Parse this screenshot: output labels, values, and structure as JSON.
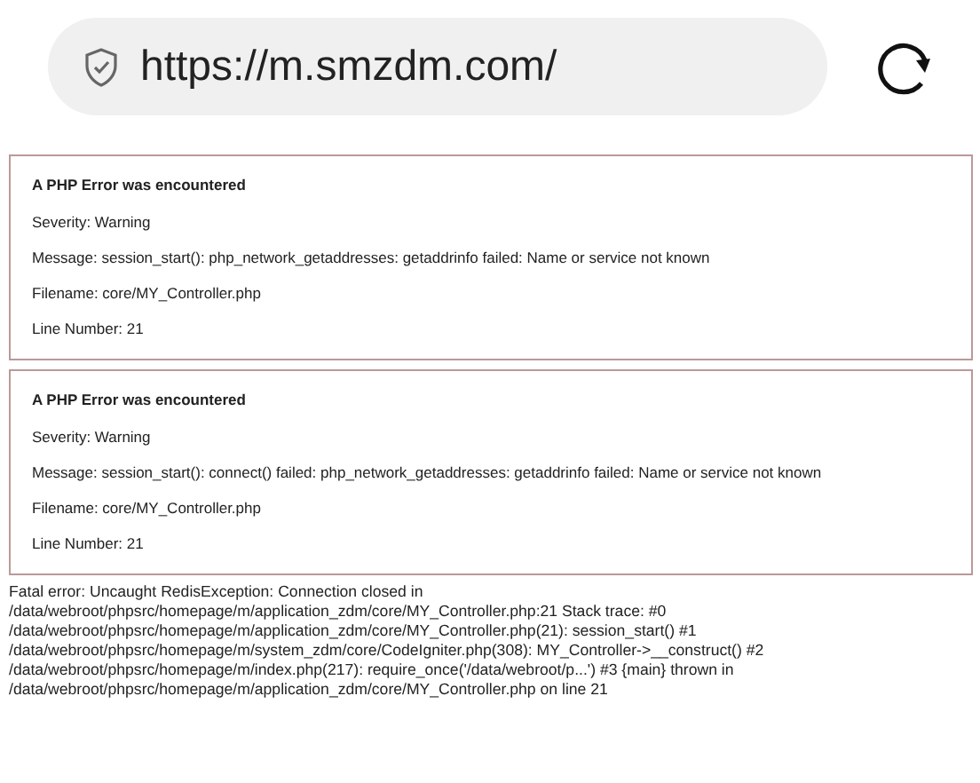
{
  "address_bar": {
    "url": "https://m.smzdm.com/"
  },
  "errors": [
    {
      "title": "A PHP Error was encountered",
      "lines": [
        "Severity: Warning",
        "Message: session_start(): php_network_getaddresses: getaddrinfo failed: Name or service not known",
        "Filename: core/MY_Controller.php",
        "Line Number: 21"
      ]
    },
    {
      "title": "A PHP Error was encountered",
      "lines": [
        "Severity: Warning",
        "Message: session_start(): connect() failed: php_network_getaddresses: getaddrinfo failed: Name or service not known",
        "Filename: core/MY_Controller.php",
        "Line Number: 21"
      ]
    }
  ],
  "fatal_error": [
    "Fatal error: Uncaught RedisException: Connection closed in",
    "/data/webroot/phpsrc/homepage/m/application_zdm/core/MY_Controller.php:21 Stack trace: #0",
    "/data/webroot/phpsrc/homepage/m/application_zdm/core/MY_Controller.php(21): session_start() #1",
    "/data/webroot/phpsrc/homepage/m/system_zdm/core/CodeIgniter.php(308): MY_Controller->__construct() #2",
    "/data/webroot/phpsrc/homepage/m/index.php(217): require_once('/data/webroot/p...') #3 {main} thrown in",
    "/data/webroot/phpsrc/homepage/m/application_zdm/core/MY_Controller.php on line 21"
  ]
}
